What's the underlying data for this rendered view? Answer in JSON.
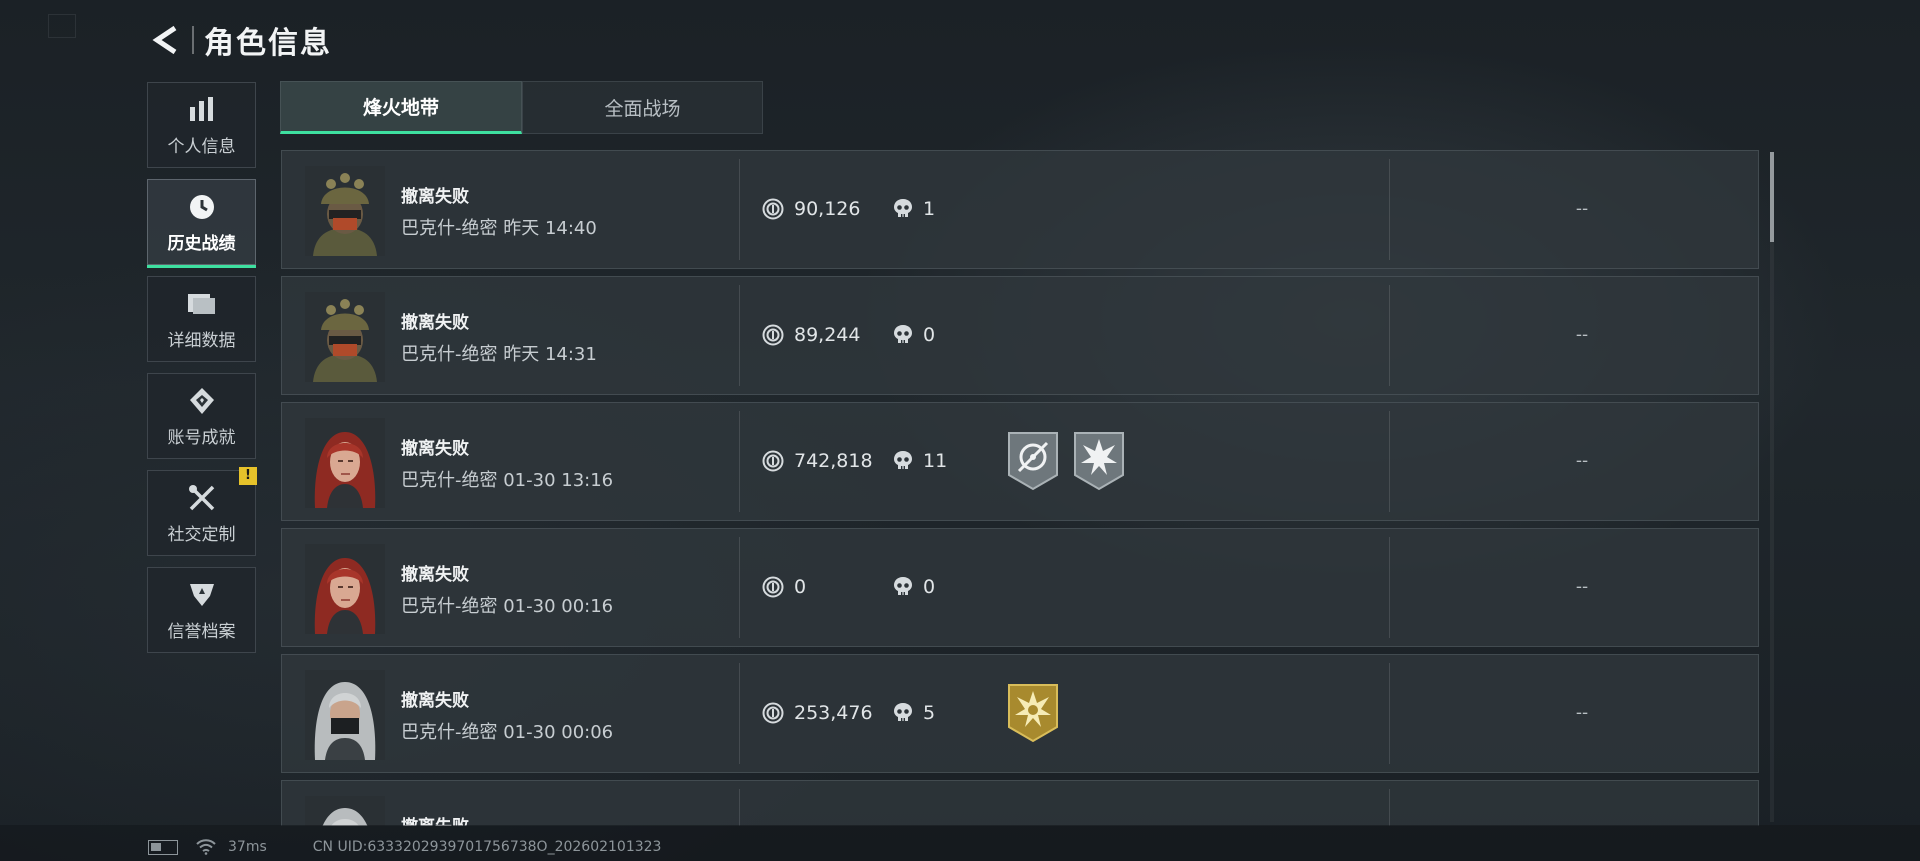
{
  "header": {
    "title": "角色信息"
  },
  "sidebar": {
    "items": [
      {
        "label": "个人信息",
        "icon": "bar-chart-icon",
        "active": false
      },
      {
        "label": "历史战绩",
        "icon": "clock-icon",
        "active": true
      },
      {
        "label": "详细数据",
        "icon": "folder-icon",
        "active": false
      },
      {
        "label": "账号成就",
        "icon": "achievement-icon",
        "active": false
      },
      {
        "label": "社交定制",
        "icon": "tools-icon",
        "active": false,
        "badge": "!"
      },
      {
        "label": "信誉档案",
        "icon": "shield-icon",
        "active": false
      }
    ]
  },
  "tabs": [
    {
      "label": "烽火地带",
      "active": true
    },
    {
      "label": "全面战场",
      "active": false
    }
  ],
  "records": [
    {
      "status": "撤离失败",
      "meta": "巴克什-绝密 昨天 14:40",
      "value": "90,126",
      "kills": "1",
      "result": "--",
      "avatar": "soldier-helmet",
      "medals": []
    },
    {
      "status": "撤离失败",
      "meta": "巴克什-绝密 昨天 14:31",
      "value": "89,244",
      "kills": "0",
      "result": "--",
      "avatar": "soldier-helmet",
      "medals": []
    },
    {
      "status": "撤离失败",
      "meta": "巴克什-绝密 01-30 13:16",
      "value": "742,818",
      "kills": "11",
      "result": "--",
      "avatar": "red-hair",
      "medals": [
        "crosshair-medal-icon",
        "explosion-medal-icon"
      ]
    },
    {
      "status": "撤离失败",
      "meta": "巴克什-绝密 01-30 00:16",
      "value": "0",
      "kills": "0",
      "result": "--",
      "avatar": "red-hair",
      "medals": []
    },
    {
      "status": "撤离失败",
      "meta": "巴克什-绝密 01-30 00:06",
      "value": "253,476",
      "kills": "5",
      "result": "--",
      "avatar": "silver-hair",
      "medals": [
        "gold-star-medal-icon"
      ]
    },
    {
      "status": "撤离失败"
    }
  ],
  "footer": {
    "ping": "37ms",
    "uid": "CN UID:6333202939701756738O_202602101323"
  },
  "colors": {
    "accent": "#3ee0a0",
    "warning": "#e6c22a",
    "gold_medal": "#a88a2e"
  }
}
